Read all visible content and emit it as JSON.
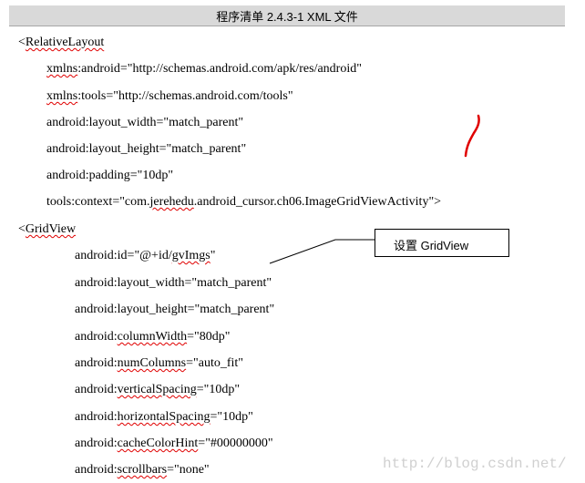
{
  "document": {
    "title": "程序清单 2.4.3-1 XML 文件",
    "lines": [
      {
        "prefix": "<",
        "word": "RelativeLayout",
        "rest": ""
      },
      {
        "prefix": "",
        "word": "xmlns",
        "rest": ":android=\"http://schemas.android.com/apk/res/android\""
      },
      {
        "prefix": "",
        "word": "xmlns",
        "rest": ":tools=\"http://schemas.android.com/tools\""
      },
      {
        "prefix": "",
        "word": "",
        "rest": "android:layout_width=\"match_parent\""
      },
      {
        "prefix": "",
        "word": "",
        "rest": "android:layout_height=\"match_parent\""
      },
      {
        "prefix": "",
        "word": "",
        "rest": "android:padding=\"10dp\""
      },
      {
        "prefix": "tools:context=\"com.",
        "word": "jerehedu",
        "rest": ".android_cursor.ch06.ImageGridViewActivity\">"
      },
      {
        "prefix": "<",
        "word": "GridView",
        "rest": ""
      },
      {
        "prefix": "android:id=\"@+id/",
        "word": "gvImgs",
        "rest": "\""
      },
      {
        "prefix": "",
        "word": "",
        "rest": "android:layout_width=\"match_parent\""
      },
      {
        "prefix": "",
        "word": "",
        "rest": "android:layout_height=\"match_parent\""
      },
      {
        "prefix": "android:",
        "word": "columnWidth",
        "rest": "=\"80dp\""
      },
      {
        "prefix": "android:",
        "word": "numColumns",
        "rest": "=\"auto_fit\""
      },
      {
        "prefix": "android:",
        "word": "verticalSpacing",
        "rest": "=\"10dp\""
      },
      {
        "prefix": "android:",
        "word": "horizontalSpacing",
        "rest": "=\"10dp\""
      },
      {
        "prefix": "android:",
        "word": "cacheColorHint",
        "rest": "=\"#00000000\""
      },
      {
        "prefix": "android:",
        "word": "scrollbars",
        "rest": "=\"none\""
      }
    ]
  },
  "callout": {
    "text": "设置 GridView"
  },
  "watermark": {
    "text": "http://blog.csdn.net/"
  },
  "colors": {
    "spellcheck_underline": "#e00000",
    "title_background": "#d9d9d9",
    "ink_mark": "#e00000"
  }
}
